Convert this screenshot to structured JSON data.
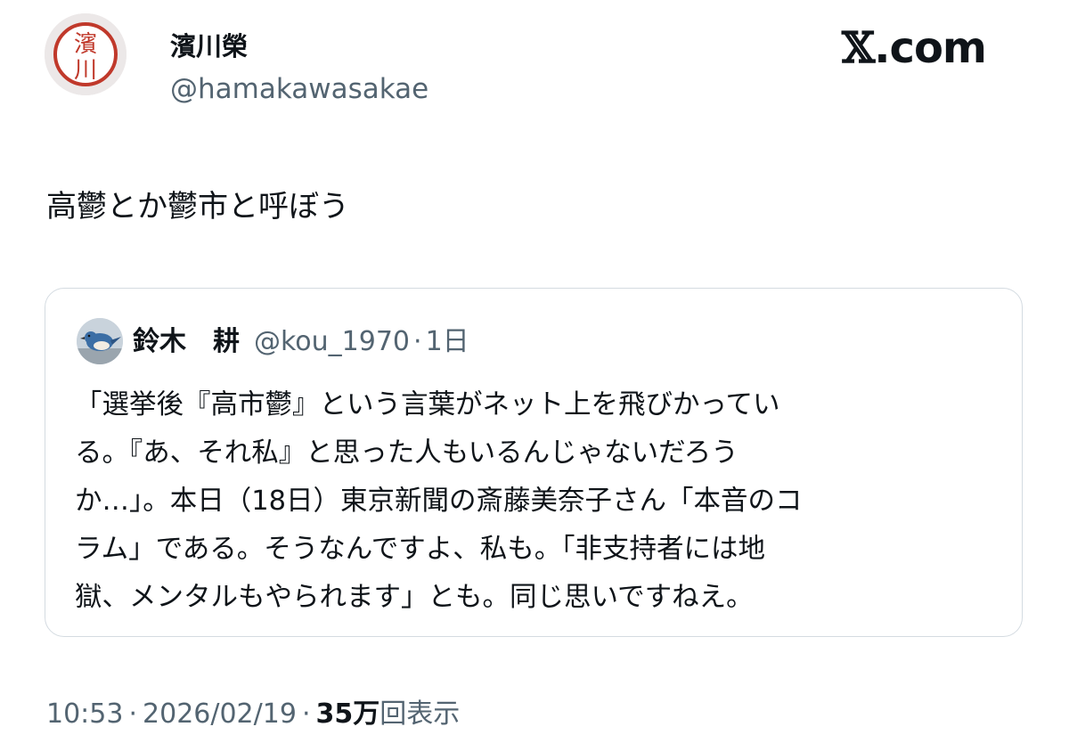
{
  "author": {
    "display_name": "濱川榮",
    "handle": "@hamakawasakae",
    "avatar_seal_text": "濱川"
  },
  "brand": {
    "x": "𝕏",
    "suffix": ".com"
  },
  "tweet": {
    "text": "高鬱とか鬱市と呼ぼう"
  },
  "quoted_tweet": {
    "display_name": "鈴木　耕",
    "handle": "@kou_1970",
    "separator": "·",
    "time": "1日",
    "avatar_icon": "bird-photo-icon",
    "lines": [
      "「選挙後『高市鬱』という言葉がネット上を飛びかってい",
      "る。『あ、それ私』と思った人もいるんじゃないだろう",
      "か…」。本日（18日）東京新聞の斎藤美奈子さん「本音のコ",
      "ラム」である。そうなんですよ、私も。「非支持者には地",
      "獄、メンタルもやられます」とも。同じ思いですねえ。"
    ]
  },
  "meta": {
    "time": "10:53",
    "separator": "·",
    "date": "2026/02/19",
    "views_count": "35万",
    "views_label": "回表示"
  },
  "colors": {
    "text_primary": "#0f1419",
    "text_secondary": "#536471",
    "border": "#d4dbe1",
    "seal_red": "#c0392b"
  }
}
